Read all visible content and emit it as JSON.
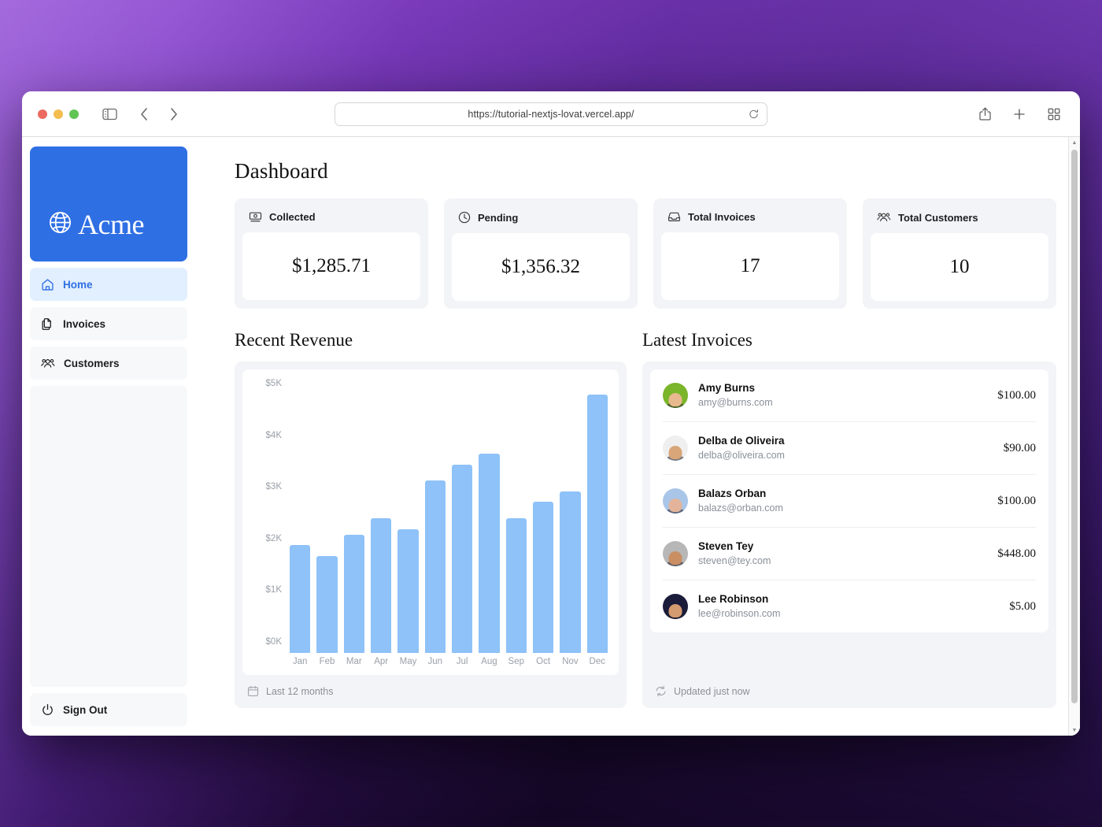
{
  "browser": {
    "url": "https://tutorial-nextjs-lovat.vercel.app/",
    "traffic_lights": [
      "close",
      "minimize",
      "zoom"
    ],
    "toolbar_icons": {
      "sidebar_toggle": "sidebar-toggle-icon",
      "back": "back-chevron-icon",
      "forward": "forward-chevron-icon",
      "reload": "reload-icon",
      "share": "share-icon",
      "new_tab": "plus-icon",
      "tab_overview": "tab-overview-icon"
    }
  },
  "sidebar": {
    "logo": {
      "text": "Acme",
      "icon": "globe-icon",
      "bg_color": "#2f6fe4"
    },
    "items": [
      {
        "label": "Home",
        "icon": "home-icon",
        "active": true
      },
      {
        "label": "Invoices",
        "icon": "document-duplicate-icon",
        "active": false
      },
      {
        "label": "Customers",
        "icon": "user-group-icon",
        "active": false
      }
    ],
    "sign_out": {
      "label": "Sign Out",
      "icon": "power-icon"
    }
  },
  "main": {
    "page_title": "Dashboard",
    "cards": [
      {
        "label": "Collected",
        "value": "$1,285.71",
        "icon": "banknotes-icon"
      },
      {
        "label": "Pending",
        "value": "$1,356.32",
        "icon": "clock-icon"
      },
      {
        "label": "Total Invoices",
        "value": "17",
        "icon": "inbox-icon"
      },
      {
        "label": "Total Customers",
        "value": "10",
        "icon": "user-group-icon"
      }
    ],
    "revenue_section": {
      "heading": "Recent Revenue",
      "footer_label": "Last 12 months",
      "footer_icon": "calendar-icon"
    },
    "invoices_section": {
      "heading": "Latest Invoices",
      "footer_label": "Updated just now",
      "footer_icon": "refresh-icon",
      "rows": [
        {
          "name": "Amy Burns",
          "email": "amy@burns.com",
          "amount": "$100.00",
          "avatar_color": "#7ab52a",
          "skin": "#e8b98e"
        },
        {
          "name": "Delba de Oliveira",
          "email": "delba@oliveira.com",
          "amount": "$90.00",
          "avatar_color": "#efefef",
          "skin": "#d9a679"
        },
        {
          "name": "Balazs Orban",
          "email": "balazs@orban.com",
          "amount": "$100.00",
          "avatar_color": "#a9c6e8",
          "skin": "#e3b49b"
        },
        {
          "name": "Steven Tey",
          "email": "steven@tey.com",
          "amount": "$448.00",
          "avatar_color": "#b7b7b7",
          "skin": "#c98f63"
        },
        {
          "name": "Lee Robinson",
          "email": "lee@robinson.com",
          "amount": "$5.00",
          "avatar_color": "#1b1b3a",
          "skin": "#d49a70"
        }
      ]
    }
  },
  "chart_data": {
    "type": "bar",
    "title": "Recent Revenue",
    "xlabel": "",
    "ylabel": "",
    "categories": [
      "Jan",
      "Feb",
      "Mar",
      "Apr",
      "May",
      "Jun",
      "Jul",
      "Aug",
      "Sep",
      "Oct",
      "Nov",
      "Dec"
    ],
    "values": [
      2000,
      1800,
      2200,
      2500,
      2300,
      3200,
      3500,
      3700,
      2500,
      2800,
      3000,
      4800
    ],
    "y_ticks": [
      "$5K",
      "$4K",
      "$3K",
      "$2K",
      "$1K",
      "$0K"
    ],
    "ylim": [
      0,
      5000
    ],
    "grid": false,
    "legend": false,
    "bar_color": "#8ec2f8"
  },
  "colors": {
    "brand_blue": "#2f6fe4",
    "active_nav_bg": "#e1effe",
    "panel_bg": "#f3f4f7",
    "bar_blue": "#8ec2f8"
  }
}
